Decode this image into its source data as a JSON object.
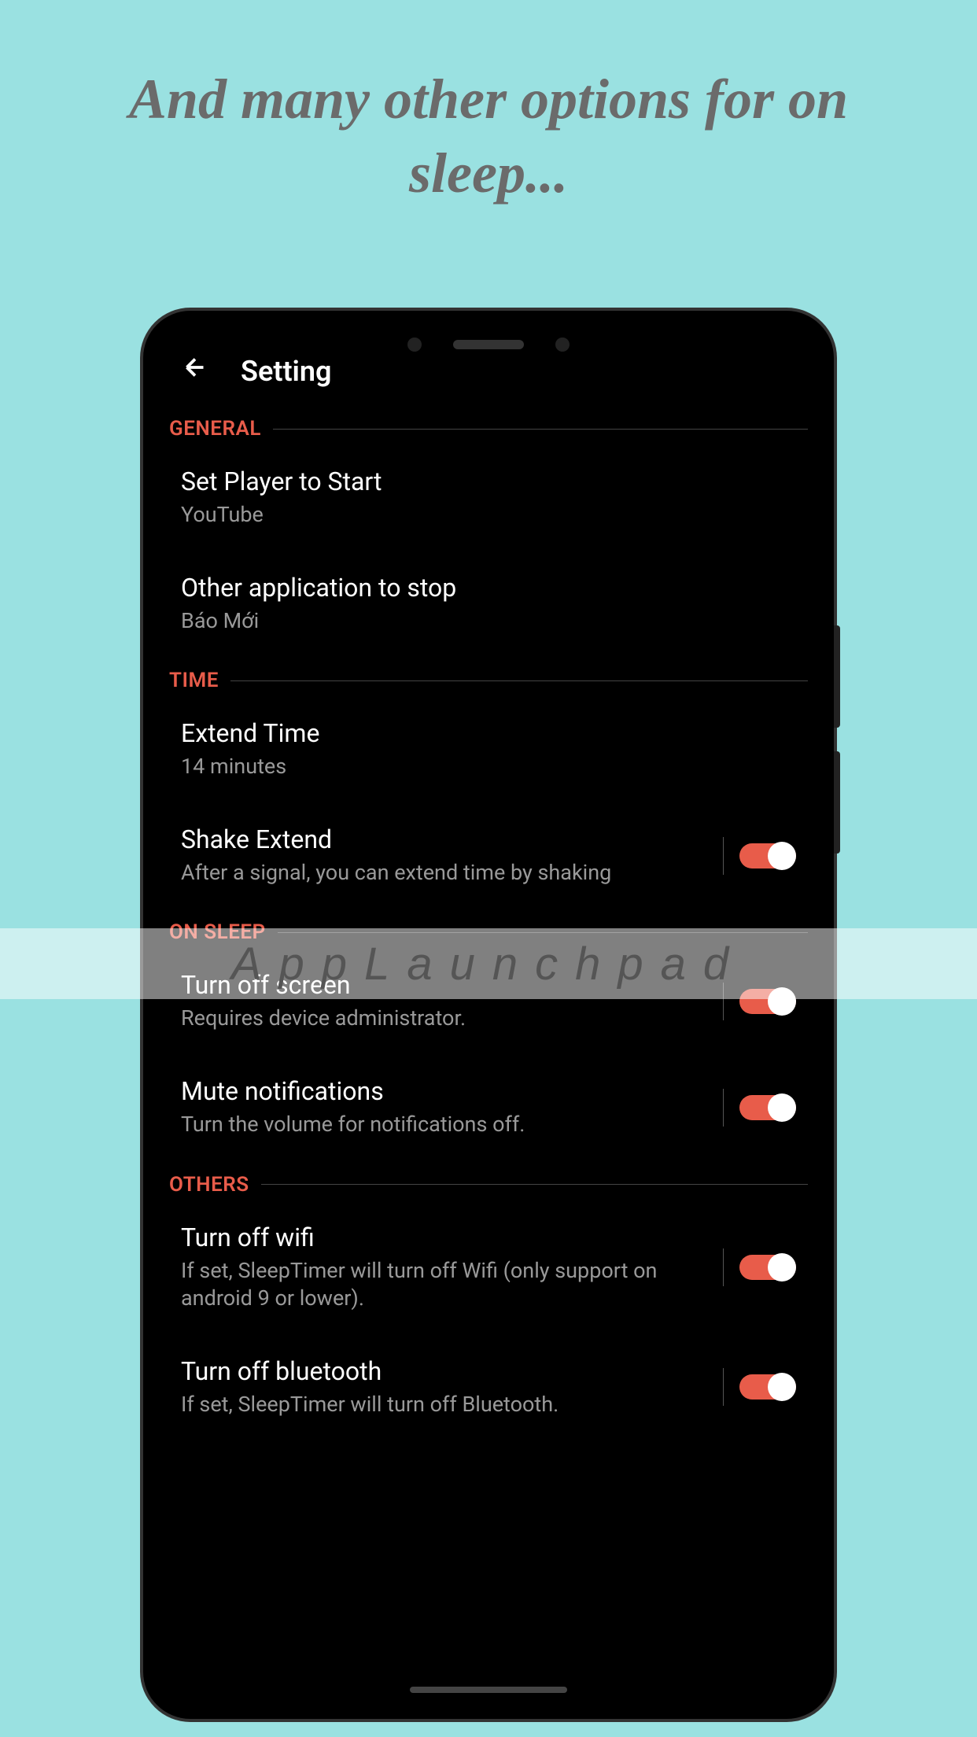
{
  "promo": {
    "text": "And many other options for on sleep..."
  },
  "header": {
    "title": "Setting"
  },
  "sections": {
    "general": {
      "label": "GENERAL",
      "items": [
        {
          "title": "Set Player to Start",
          "subtitle": "YouTube"
        },
        {
          "title": "Other application to stop",
          "subtitle": "Báo Mới"
        }
      ]
    },
    "time": {
      "label": "TIME",
      "items": [
        {
          "title": "Extend Time",
          "subtitle": "14 minutes"
        },
        {
          "title": "Shake Extend",
          "subtitle": "After a signal, you can extend time by shaking",
          "toggle": true
        }
      ]
    },
    "onsleep": {
      "label": "ON SLEEP",
      "items": [
        {
          "title": "Turn off screen",
          "subtitle": "Requires device administrator.",
          "toggle": true
        },
        {
          "title": "Mute notifications",
          "subtitle": "Turn the volume for notifications off.",
          "toggle": true
        }
      ]
    },
    "others": {
      "label": "OTHERS",
      "items": [
        {
          "title": "Turn off wifi",
          "subtitle": "If set, SleepTimer will turn off Wifi (only support on android 9 or lower).",
          "toggle": true
        },
        {
          "title": "Turn off bluetooth",
          "subtitle": "If set, SleepTimer will turn off Bluetooth.",
          "toggle": true
        }
      ]
    }
  },
  "watermark": "AppLaunchpad"
}
